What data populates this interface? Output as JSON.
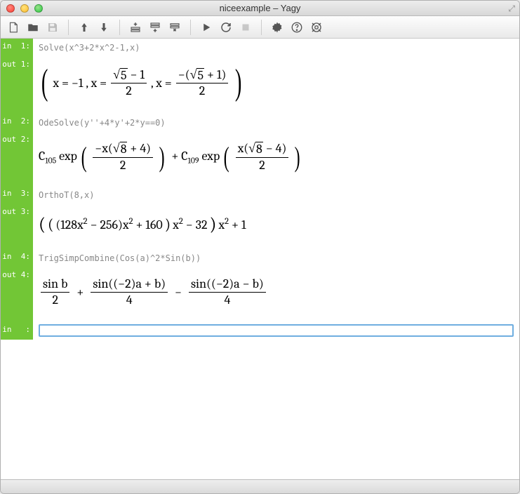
{
  "window": {
    "title": "niceexample – Yagy"
  },
  "toolbar": {
    "new": "New",
    "open": "Open",
    "save": "Save",
    "up": "Up",
    "down": "Down",
    "insert_above": "Insert above",
    "insert_below": "Insert below",
    "delete": "Delete",
    "run": "Run",
    "reload": "Reload",
    "stop": "Stop",
    "settings": "Settings",
    "help": "Help",
    "target": "Target"
  },
  "cells": {
    "in1": {
      "label": "in  1:",
      "code": "Solve(x^3+2*x^2-1,x)"
    },
    "out1": {
      "label": "out 1:",
      "text_plain": "( x = -1 , x = (√5 − 1)/2 , x = −(√5 + 1)/2 )"
    },
    "in2": {
      "label": "in  2:",
      "code": "OdeSolve(y''+4*y'+2*y==0)"
    },
    "out2": {
      "label": "out 2:",
      "text_plain": "C105 exp( −x(√8 + 4)/2 ) + C109 exp( x(√8 − 4)/2 )"
    },
    "in3": {
      "label": "in  3:",
      "code": "OrthoT(8,x)"
    },
    "out3": {
      "label": "out 3:",
      "text_plain": "(((128x² − 256)x² + 160)x² − 32)x² + 1"
    },
    "in4": {
      "label": "in  4:",
      "code": "TrigSimpCombine(Cos(a)^2*Sin(b))"
    },
    "out4": {
      "label": "out 4:",
      "text_plain": "sin b / 2 + sin((−2)a + b)/4 − sin((−2)a − b)/4"
    },
    "current": {
      "label": "in   :",
      "value": ""
    }
  }
}
